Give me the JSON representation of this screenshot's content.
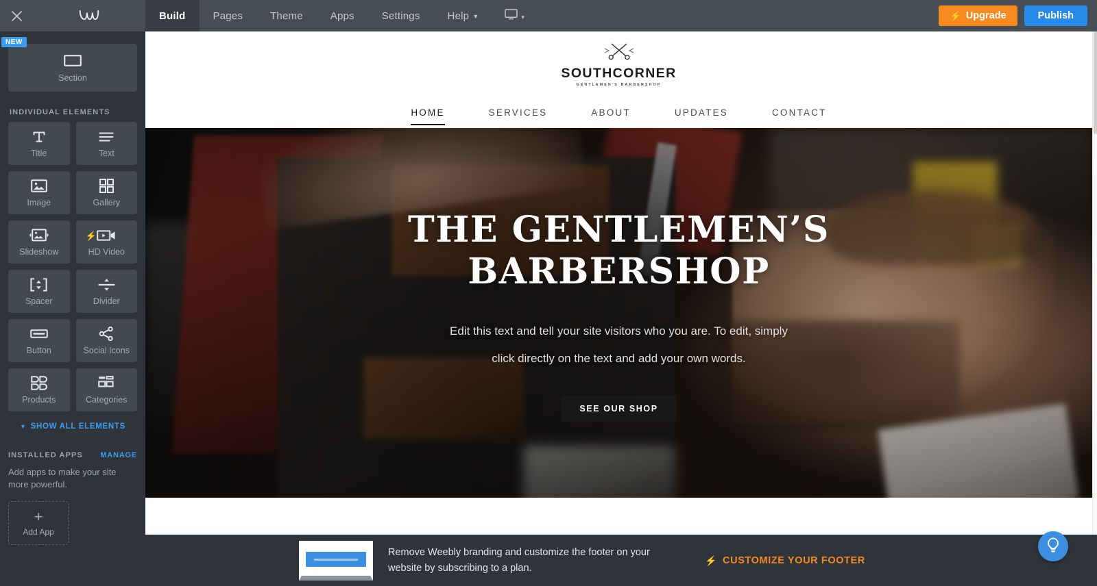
{
  "topbar": {
    "close_icon": "close-icon",
    "logo_icon": "weebly-logo-icon",
    "nav": [
      {
        "label": "Build",
        "active": true,
        "has_caret": false
      },
      {
        "label": "Pages",
        "active": false,
        "has_caret": false
      },
      {
        "label": "Theme",
        "active": false,
        "has_caret": false
      },
      {
        "label": "Apps",
        "active": false,
        "has_caret": false
      },
      {
        "label": "Settings",
        "active": false,
        "has_caret": false
      },
      {
        "label": "Help",
        "active": false,
        "has_caret": true
      }
    ],
    "device_icon": "monitor-icon",
    "device_caret": "▾",
    "upgrade_label": "Upgrade",
    "upgrade_color": "#f68a1e",
    "publish_label": "Publish",
    "publish_color": "#2789e8",
    "bolt_glyph": "⚡"
  },
  "sidebar": {
    "section": {
      "badge": "NEW",
      "badge_color": "#3c9cf0",
      "label": "Section",
      "icon": "rectangle-icon"
    },
    "elements_title": "INDIVIDUAL ELEMENTS",
    "elements": [
      {
        "label": "Title",
        "icon": "title-t-icon",
        "pro": false
      },
      {
        "label": "Text",
        "icon": "text-lines-icon",
        "pro": false
      },
      {
        "label": "Image",
        "icon": "image-icon",
        "pro": false
      },
      {
        "label": "Gallery",
        "icon": "gallery-grid-icon",
        "pro": false
      },
      {
        "label": "Slideshow",
        "icon": "slideshow-icon",
        "pro": false
      },
      {
        "label": "HD Video",
        "icon": "hd-video-icon",
        "pro": true
      },
      {
        "label": "Spacer",
        "icon": "spacer-icon",
        "pro": false
      },
      {
        "label": "Divider",
        "icon": "divider-icon",
        "pro": false
      },
      {
        "label": "Button",
        "icon": "button-icon",
        "pro": false
      },
      {
        "label": "Social Icons",
        "icon": "social-share-icon",
        "pro": false
      },
      {
        "label": "Products",
        "icon": "products-icon",
        "pro": false
      },
      {
        "label": "Categories",
        "icon": "categories-icon",
        "pro": false
      }
    ],
    "show_all": "SHOW ALL ELEMENTS",
    "show_all_caret": "▼",
    "installed_apps_title": "INSTALLED APPS",
    "manage_label": "MANAGE",
    "apps_description": "Add apps to make your site more powerful.",
    "add_app_label": "Add App",
    "add_app_plus": "+"
  },
  "site": {
    "logo": {
      "name": "SOUTHCORNER",
      "tagline": "GENTLEMEN'S BARBERSHOP",
      "icon": "crossed-scissors-icon"
    },
    "nav": [
      {
        "label": "HOME",
        "active": true
      },
      {
        "label": "SERVICES",
        "active": false
      },
      {
        "label": "ABOUT",
        "active": false
      },
      {
        "label": "UPDATES",
        "active": false
      },
      {
        "label": "CONTACT",
        "active": false
      }
    ],
    "hero": {
      "title": "THE GENTLEMEN’S BARBERSHOP",
      "subtitle": "Edit this text and tell your site visitors who you are. To edit, simply click directly on the text and add your own words.",
      "button_label": "SEE OUR SHOP",
      "image_description": "barber shaving a reclining bearded client in a barbershop"
    }
  },
  "help": {
    "icon": "lightbulb-icon",
    "color": "#3c8fe0"
  },
  "footer_banner": {
    "thumb_icon": "site-preview-thumbnail",
    "text": "Remove Weebly branding and customize the footer on your website by subscribing to a plan.",
    "cta_label": "CUSTOMIZE YOUR FOOTER",
    "cta_color": "#f68a1e",
    "bolt_glyph": "⚡"
  }
}
